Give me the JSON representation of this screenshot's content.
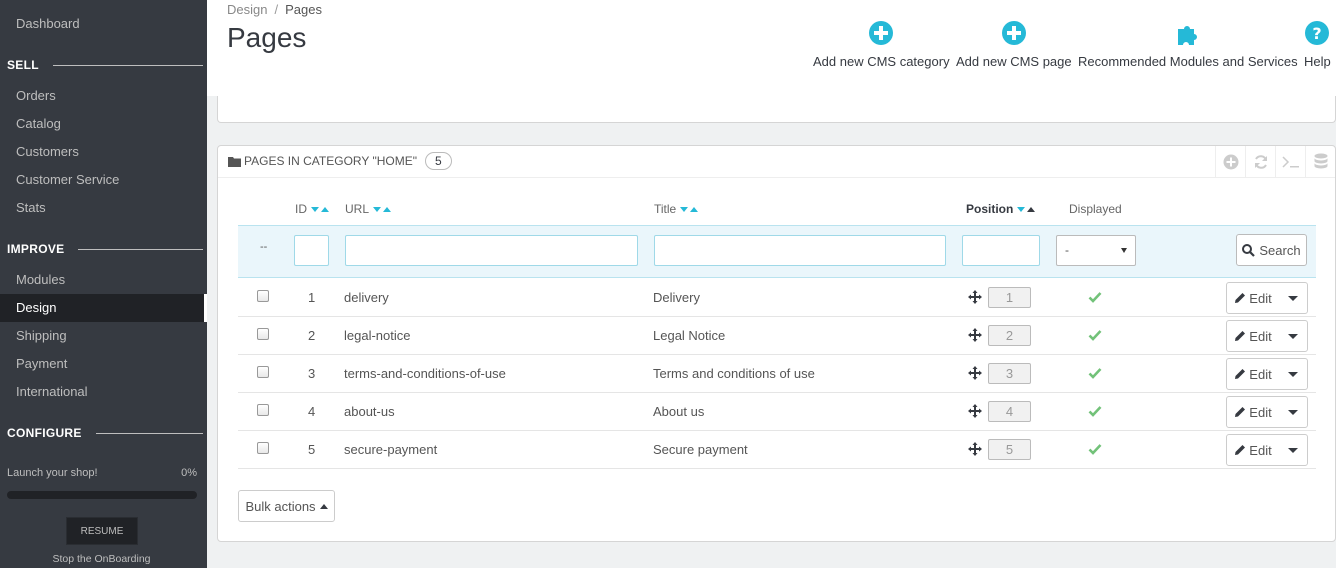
{
  "sidebar": {
    "dashboard": "Dashboard",
    "sections": [
      {
        "title": "SELL"
      },
      {
        "title": "IMPROVE"
      },
      {
        "title": "CONFIGURE"
      }
    ],
    "sell_items": [
      "Orders",
      "Catalog",
      "Customers",
      "Customer Service",
      "Stats"
    ],
    "improve_items": [
      "Modules",
      "Design",
      "Shipping",
      "Payment",
      "International"
    ],
    "active_item": "Design",
    "launch_label": "Launch your shop!",
    "launch_percent": "0%",
    "launch_progress": 0,
    "resume_label": "RESUME",
    "stop_label": "Stop the OnBoarding"
  },
  "header": {
    "breadcrumb": [
      "Design",
      "Pages"
    ],
    "title": "Pages",
    "toolbar": [
      {
        "label": "Add new CMS category",
        "icon": "plus-circle-icon"
      },
      {
        "label": "Add new CMS page",
        "icon": "plus-circle-icon"
      },
      {
        "label": "Recommended Modules and Services",
        "icon": "puzzle-icon"
      },
      {
        "label": "Help",
        "icon": "question-circle-icon"
      }
    ]
  },
  "panel": {
    "title": "PAGES IN CATEGORY \"HOME\"",
    "count": "5",
    "columns": {
      "id": "ID",
      "url": "URL",
      "title": "Title",
      "position": "Position",
      "displayed": "Displayed"
    },
    "filter": {
      "bulk_placeholder": "--",
      "displayed_value": "-",
      "search_label": "Search"
    },
    "rows": [
      {
        "id": "1",
        "url": "delivery",
        "title": "Delivery",
        "position": "1",
        "displayed": true
      },
      {
        "id": "2",
        "url": "legal-notice",
        "title": "Legal Notice",
        "position": "2",
        "displayed": true
      },
      {
        "id": "3",
        "url": "terms-and-conditions-of-use",
        "title": "Terms and conditions of use",
        "position": "3",
        "displayed": true
      },
      {
        "id": "4",
        "url": "about-us",
        "title": "About us",
        "position": "4",
        "displayed": true
      },
      {
        "id": "5",
        "url": "secure-payment",
        "title": "Secure payment",
        "position": "5",
        "displayed": true
      }
    ],
    "edit_label": "Edit",
    "bulk_label": "Bulk actions"
  },
  "colors": {
    "accent": "#25b9d7",
    "success": "#72c279",
    "sidebar_bg": "#363a41"
  }
}
